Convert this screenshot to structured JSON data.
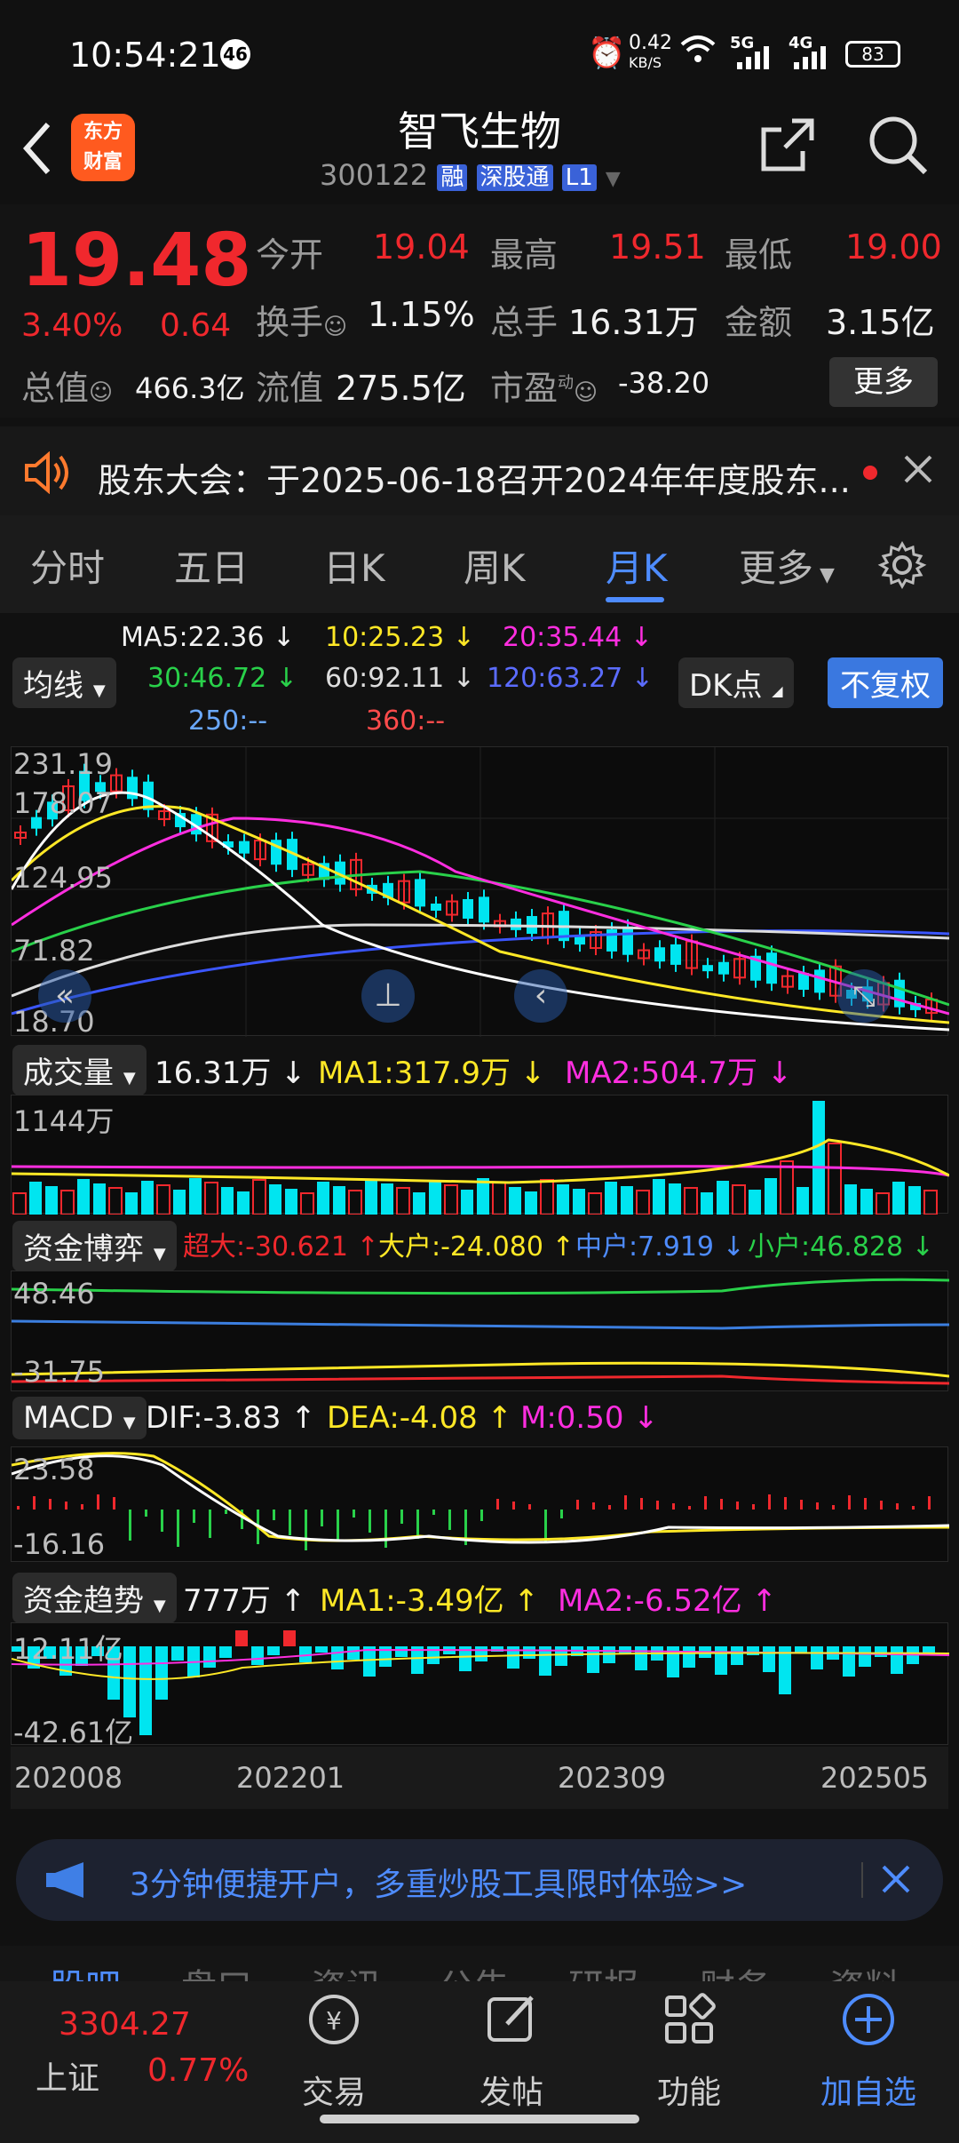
{
  "status_bar": {
    "time": "10:54:21",
    "notif_count": "46",
    "net_speed_value": "0.42",
    "net_speed_unit": "KB/S",
    "signal_1": "5G",
    "signal_2": "4G",
    "battery": "83"
  },
  "header": {
    "logo_text_1": "东方",
    "logo_text_2": "财富",
    "stock_name": "智飞生物",
    "stock_code": "300122",
    "tag_rong": "融",
    "tag_market": "深股通",
    "tag_level": "L1"
  },
  "quote": {
    "price": "19.48",
    "change_pct": "3.40%",
    "change_amt": "0.64",
    "open_label": "今开",
    "open": "19.04",
    "high_label": "最高",
    "high": "19.51",
    "low_label": "最低",
    "low": "19.00",
    "turnover_label": "换手",
    "turnover": "1.15%",
    "volume_label": "总手",
    "volume": "16.31万",
    "amount_label": "金额",
    "amount": "3.15亿",
    "mktcap_label": "总值",
    "mktcap": "466.3亿",
    "float_label": "流值",
    "float": "275.5亿",
    "pe_label": "市盈",
    "pe_sup": "动",
    "pe": "-38.20",
    "more_button": "更多"
  },
  "notice": {
    "text": "股东大会：于2025-06-18召开2024年年度股东..."
  },
  "tabs": [
    "分时",
    "五日",
    "日K",
    "周K",
    "月K",
    "更多"
  ],
  "active_tab": "月K",
  "ma_legend": {
    "ma5": "MA5:22.36",
    "ma10": "10:25.23",
    "ma20": "20:35.44",
    "ma30": "30:46.72",
    "ma60": "60:92.11",
    "ma120": "120:63.27",
    "ma250": "250:--",
    "ma360": "360:--",
    "indicator_dropdown": "均线",
    "dk_button": "DK点",
    "fq_button": "不复权"
  },
  "colors": {
    "up": "#f0282d",
    "down": "#00e5f0",
    "ma5": "#ffffff",
    "ma10": "#ffe826",
    "ma20": "#ff2ee0",
    "ma30": "#29d14a",
    "ma60": "#dddddd",
    "ma120": "#3b56ff",
    "accent": "#4e8cff"
  },
  "kline_axis": {
    "y1": "231.19",
    "y2": "178.07",
    "y3": "124.95",
    "y4": "71.82",
    "y5": "18.70"
  },
  "volume_panel": {
    "dropdown": "成交量",
    "vol": "16.31万",
    "ma1": "MA1:317.9万",
    "ma2": "MA2:504.7万",
    "ymax": "1144万"
  },
  "capital_panel": {
    "dropdown": "资金博弈",
    "super": "超大:-30.621",
    "big": "大户:-24.080",
    "mid": "中户:7.919",
    "small": "小户:46.828",
    "ymax": "48.46",
    "ymin": "-31.75"
  },
  "macd_panel": {
    "dropdown": "MACD",
    "dif": "DIF:-3.83",
    "dea": "DEA:-4.08",
    "m": "M:0.50",
    "ymax": "23.58",
    "ymin": "-16.16"
  },
  "trend_panel": {
    "dropdown": "资金趋势",
    "val": "777万",
    "ma1": "MA1:-3.49亿",
    "ma2": "MA2:-6.52亿",
    "ymax": "12.11亿",
    "ymin": "-42.61亿"
  },
  "x_axis": [
    "202008",
    "202201",
    "202309",
    "202505"
  ],
  "banner": {
    "text": "3分钟便捷开户，多重炒股工具限时体验>>"
  },
  "sub_tabs": [
    "股吧",
    "盘口",
    "资讯",
    "公告",
    "研报",
    "财务",
    "资料"
  ],
  "bottom_nav": {
    "index_value": "3304.27",
    "index_name": "上证",
    "index_pct": "0.77%",
    "trade": "交易",
    "post": "发帖",
    "func": "功能",
    "add": "加自选"
  }
}
